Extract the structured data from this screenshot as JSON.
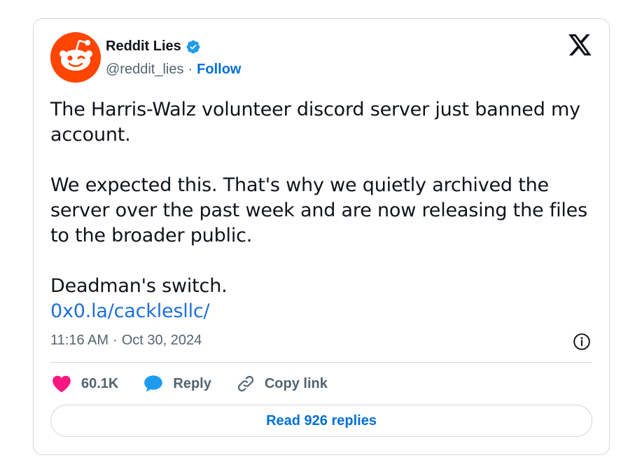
{
  "author": {
    "name": "Reddit Lies",
    "handle": "@reddit_lies",
    "separator": "·",
    "follow_label": "Follow"
  },
  "post": {
    "paragraphs": [
      "The Harris-Walz volunteer discord server just banned my account.",
      "We expected this. That's why we quietly archived the server over the past week and are now releasing the files to the broader public.",
      "Deadman's switch."
    ],
    "link": "0x0.la/cacklesllc/"
  },
  "meta": {
    "time": "11:16 AM",
    "separator": "·",
    "date": "Oct 30, 2024"
  },
  "actions": {
    "likes": "60.1K",
    "reply_label": "Reply",
    "copy_link_label": "Copy link"
  },
  "read_replies_label": "Read 926 replies",
  "colors": {
    "accent": "#006fd6",
    "like": "#f91880",
    "reddit_orange": "#ff4500",
    "verified": "#1d9bf0"
  },
  "icons": {
    "avatar": "reddit-snoo-icon",
    "verified": "verified-badge-icon",
    "platform": "x-logo-icon",
    "info": "info-icon",
    "like": "heart-icon",
    "reply": "speech-bubble-icon",
    "copy": "link-icon"
  }
}
